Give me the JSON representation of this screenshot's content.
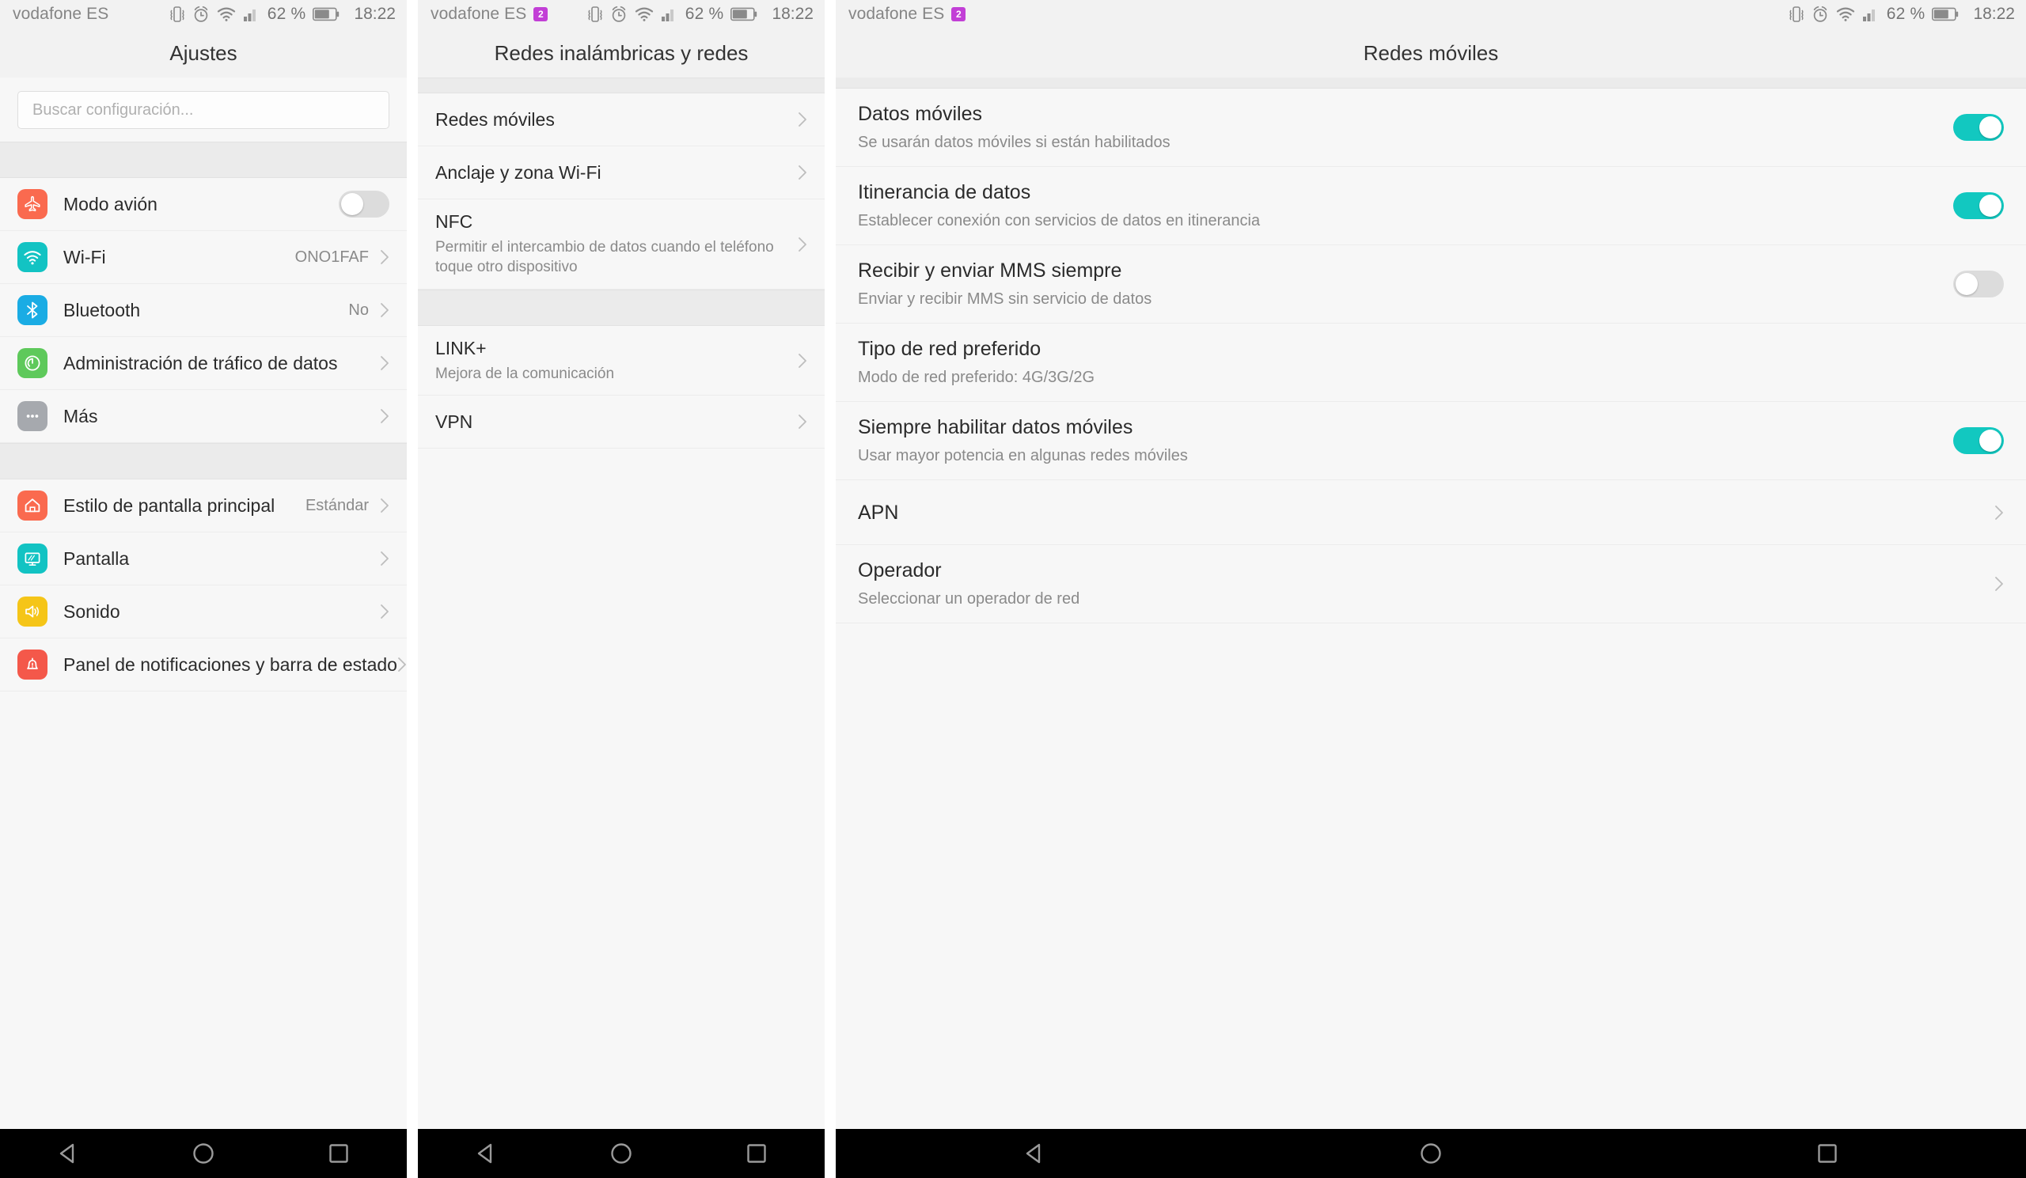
{
  "status_bar": {
    "carrier": "vodafone ES",
    "sim_badge_label": "2",
    "battery_percent": "62 %",
    "time": "18:22",
    "icons": [
      "vibrate-icon",
      "alarm-icon",
      "wifi-icon",
      "signal-icon",
      "battery-icon"
    ]
  },
  "colors": {
    "toggle_on": "#12c8c0",
    "toggle_off": "#dcdcdc",
    "airplane": "#fa6a4f",
    "wifi": "#12c3c3",
    "bluetooth": "#1aace4",
    "data_traffic": "#5ec95b",
    "more": "#a6a9ae",
    "home_style": "#fa6a4f",
    "display": "#12c3c3",
    "sound": "#f5c518",
    "notification": "#f4584a",
    "sim_badge": "#c23fd6"
  },
  "panel1": {
    "title": "Ajustes",
    "search": {
      "placeholder": "Buscar configuración..."
    },
    "group1": [
      {
        "icon": "airplane-icon",
        "label": "Modo avión",
        "control": "switch",
        "switch_on": false
      },
      {
        "icon": "wifi-icon",
        "label": "Wi-Fi",
        "value": "ONO1FAF",
        "control": "chevron"
      },
      {
        "icon": "bluetooth-icon",
        "label": "Bluetooth",
        "value": "No",
        "control": "chevron"
      },
      {
        "icon": "speedometer-icon",
        "label": "Administración de tráfico de datos",
        "value": "",
        "control": "chevron"
      },
      {
        "icon": "more-dots-icon",
        "label": "Más",
        "value": "",
        "control": "chevron"
      }
    ],
    "group2": [
      {
        "icon": "home-icon",
        "label": "Estilo de pantalla principal",
        "value": "Estándar",
        "control": "chevron"
      },
      {
        "icon": "monitor-icon",
        "label": "Pantalla",
        "value": "",
        "control": "chevron"
      },
      {
        "icon": "speaker-icon",
        "label": "Sonido",
        "value": "",
        "control": "chevron"
      },
      {
        "icon": "bell-icon",
        "label": "Panel de notificaciones y barra de estado",
        "value": "",
        "control": "chevron"
      }
    ]
  },
  "panel2": {
    "title": "Redes inalámbricas y redes",
    "group1": [
      {
        "title": "Redes móviles",
        "subtitle": ""
      },
      {
        "title": "Anclaje y zona Wi-Fi",
        "subtitle": ""
      },
      {
        "title": "NFC",
        "subtitle": "Permitir el intercambio de datos cuando el teléfono toque otro dispositivo"
      }
    ],
    "group2": [
      {
        "title": "LINK+",
        "subtitle": "Mejora de la comunicación"
      },
      {
        "title": "VPN",
        "subtitle": ""
      }
    ]
  },
  "panel3": {
    "title": "Redes móviles",
    "rows": [
      {
        "title": "Datos móviles",
        "subtitle": "Se usarán datos móviles si están habilitados",
        "control": "switch",
        "switch_on": true
      },
      {
        "title": "Itinerancia de datos",
        "subtitle": "Establecer conexión con servicios de datos en itinerancia",
        "control": "switch",
        "switch_on": true
      },
      {
        "title": "Recibir y enviar MMS siempre",
        "subtitle": "Enviar y recibir MMS sin servicio de datos",
        "control": "switch",
        "switch_on": false
      },
      {
        "title": "Tipo de red preferido",
        "subtitle": "Modo de red preferido: 4G/3G/2G",
        "control": "none"
      },
      {
        "title": "Siempre habilitar datos móviles",
        "subtitle": "Usar mayor potencia en algunas redes móviles",
        "control": "switch",
        "switch_on": true
      },
      {
        "title": "APN",
        "subtitle": "",
        "control": "chevron"
      },
      {
        "title": "Operador",
        "subtitle": "Seleccionar un operador de red",
        "control": "chevron"
      }
    ]
  },
  "navbar": {
    "back_label": "back-button",
    "home_label": "home-button",
    "recents_label": "recents-button"
  }
}
